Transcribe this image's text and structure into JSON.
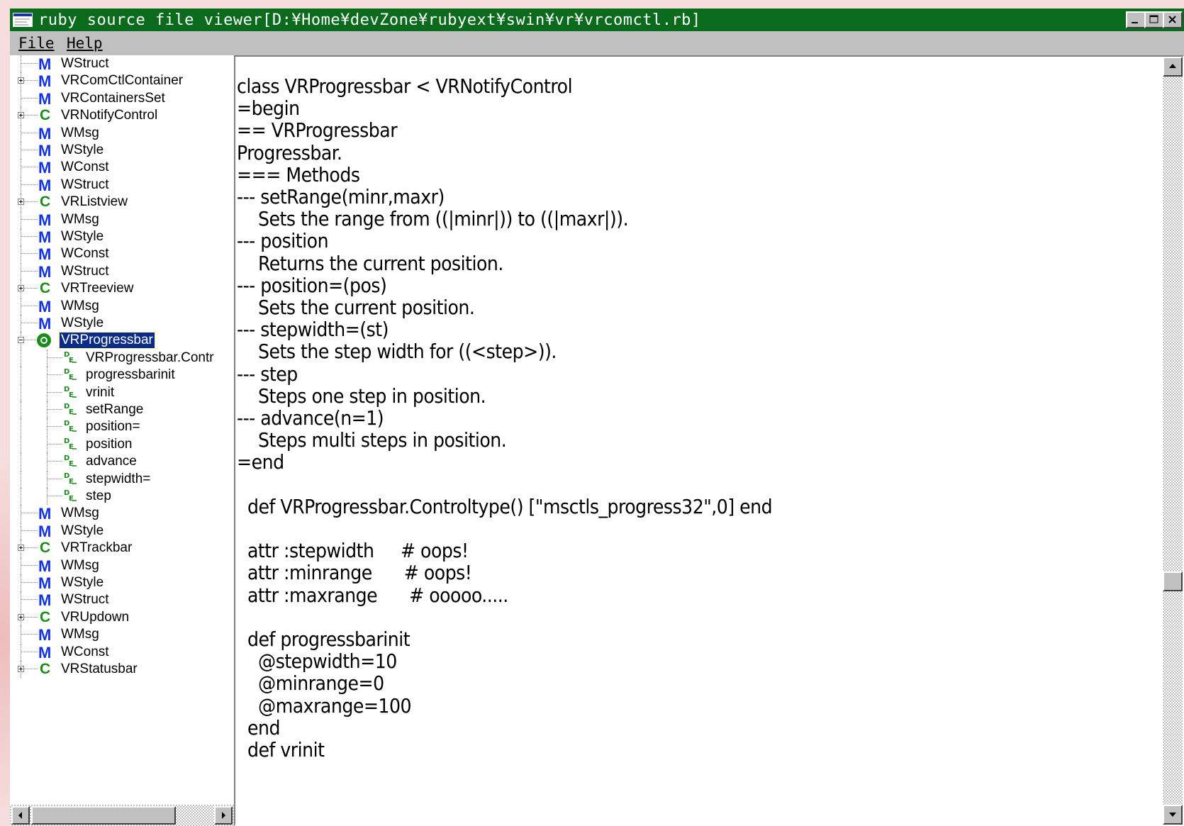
{
  "window": {
    "title": "ruby source file viewer[D:¥Home¥devZone¥rubyext¥swin¥vr¥vrcomctl.rb]"
  },
  "menu": [
    {
      "label": "File"
    },
    {
      "label": "Help"
    }
  ],
  "tree": {
    "items": [
      {
        "label": "WStruct",
        "kind": "module"
      },
      {
        "label": "VRComCtlContainer",
        "kind": "module",
        "expandable": true
      },
      {
        "label": "VRContainersSet",
        "kind": "module"
      },
      {
        "label": "VRNotifyControl",
        "kind": "class",
        "expandable": true
      },
      {
        "label": "WMsg",
        "kind": "module"
      },
      {
        "label": "WStyle",
        "kind": "module"
      },
      {
        "label": "WConst",
        "kind": "module"
      },
      {
        "label": "WStruct",
        "kind": "module"
      },
      {
        "label": "VRListview",
        "kind": "class",
        "expandable": true
      },
      {
        "label": "WMsg",
        "kind": "module"
      },
      {
        "label": "WStyle",
        "kind": "module"
      },
      {
        "label": "WConst",
        "kind": "module"
      },
      {
        "label": "WStruct",
        "kind": "module"
      },
      {
        "label": "VRTreeview",
        "kind": "class",
        "expandable": true
      },
      {
        "label": "WMsg",
        "kind": "module"
      },
      {
        "label": "WStyle",
        "kind": "module"
      },
      {
        "label": "VRProgressbar",
        "kind": "class-open",
        "selected": true
      },
      {
        "label": "VRProgressbar.Contr",
        "kind": "method"
      },
      {
        "label": "progressbarinit",
        "kind": "method"
      },
      {
        "label": "vrinit",
        "kind": "method"
      },
      {
        "label": "setRange",
        "kind": "method"
      },
      {
        "label": "position=",
        "kind": "method"
      },
      {
        "label": "position",
        "kind": "method"
      },
      {
        "label": "advance",
        "kind": "method"
      },
      {
        "label": "stepwidth=",
        "kind": "method"
      },
      {
        "label": "step",
        "kind": "method"
      },
      {
        "label": "WMsg",
        "kind": "module"
      },
      {
        "label": "WStyle",
        "kind": "module"
      },
      {
        "label": "VRTrackbar",
        "kind": "class",
        "expandable": true
      },
      {
        "label": "WMsg",
        "kind": "module"
      },
      {
        "label": "WStyle",
        "kind": "module"
      },
      {
        "label": "WStruct",
        "kind": "module"
      },
      {
        "label": "VRUpdown",
        "kind": "class",
        "expandable": true
      },
      {
        "label": "WMsg",
        "kind": "module"
      },
      {
        "label": "WConst",
        "kind": "module"
      },
      {
        "label": "VRStatusbar",
        "kind": "class",
        "expandable": true
      }
    ]
  },
  "code": {
    "lines": [
      "class VRProgressbar < VRNotifyControl",
      "=begin",
      "== VRProgressbar",
      "Progressbar.",
      "=== Methods",
      "--- setRange(minr,maxr)",
      "    Sets the range from ((|minr|)) to ((|maxr|)).",
      "--- position",
      "    Returns the current position.",
      "--- position=(pos)",
      "    Sets the current position.",
      "--- stepwidth=(st)",
      "    Sets the step width for ((<step>)).",
      "--- step",
      "    Steps one step in position.",
      "--- advance(n=1)",
      "    Steps multi steps in position.",
      "=end",
      "",
      "  def VRProgressbar.Controltype() [\"msctls_progress32\",0] end",
      "",
      "  attr :stepwidth     # oops!",
      "  attr :minrange      # oops!",
      "  attr :maxrange      # ooooo.....",
      "",
      "  def progressbarinit",
      "    @stepwidth=10",
      "    @minrange=0",
      "    @maxrange=100",
      "  end",
      "  def vrinit"
    ]
  },
  "colors": {
    "titlebar": "#0b6b1c",
    "selection": "#0a2b8a",
    "module_badge": "#1433e0",
    "class_badge": "#198c19"
  }
}
